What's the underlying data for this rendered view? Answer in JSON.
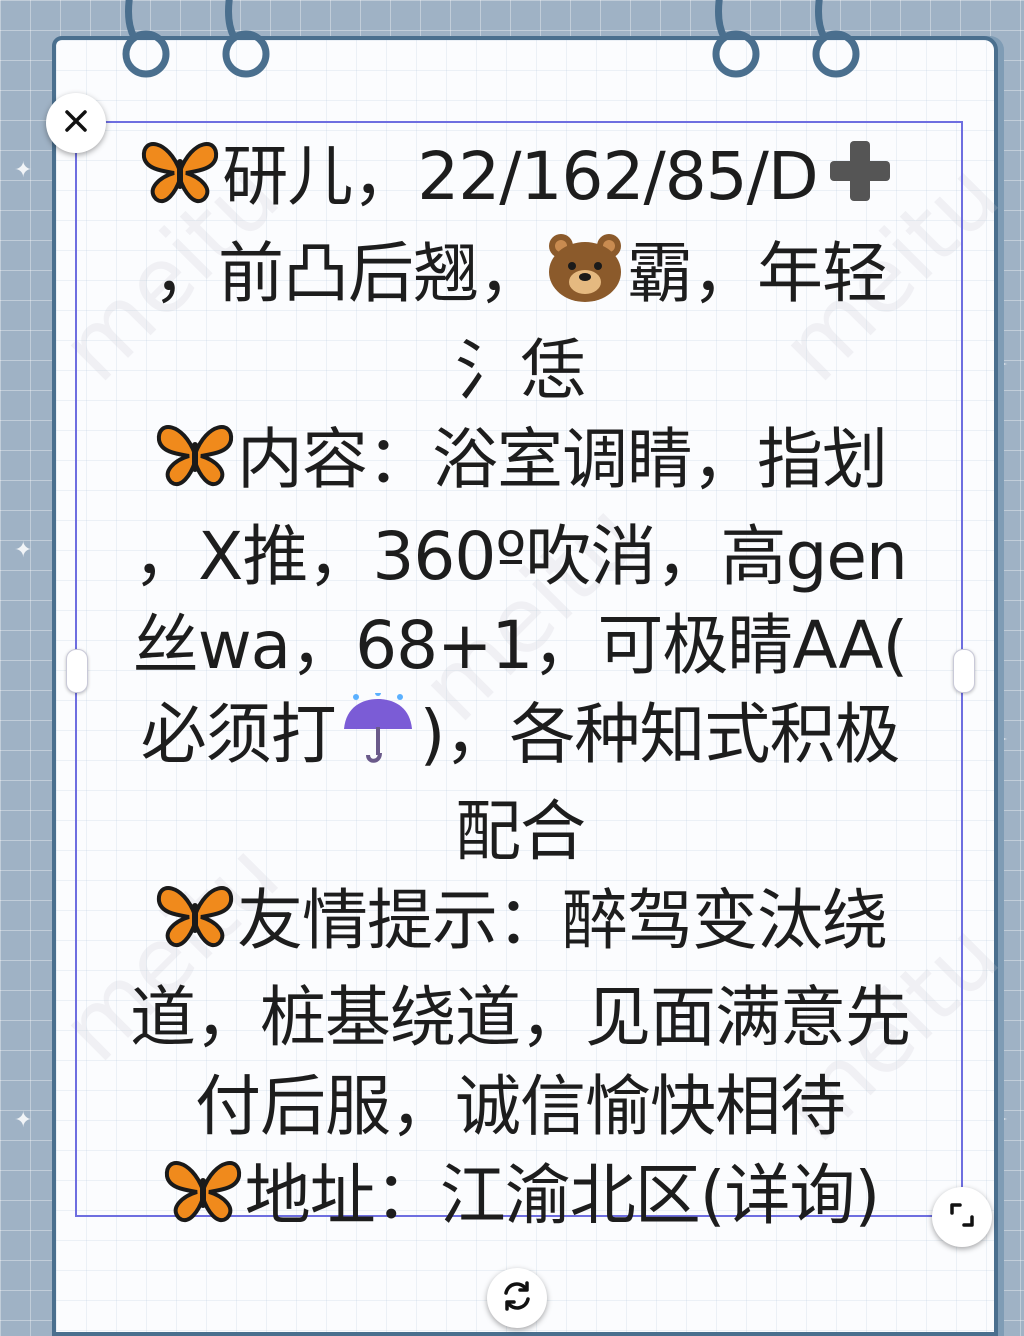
{
  "icons": {
    "close": "close-icon",
    "resize": "resize-corner-icon",
    "rotate": "rotate-icon",
    "butterfly": "butterfly-emoji",
    "plus": "plus-emoji",
    "bear": "bear-face-emoji",
    "umbrella": "umbrella-rain-emoji"
  },
  "colors": {
    "background": "#9fb2c5",
    "paper": "#fbfcfe",
    "selection_frame": "#6e6ee0",
    "text": "#1d1d1d"
  },
  "note": {
    "line1_text": "研儿，22/162/85/D",
    "line2_a": "，前凸后翘，",
    "line2_b": "霸，年轻",
    "line3": "氵恁",
    "line4_text": "内容：浴室调睛，指划",
    "line5": "，X推，360º吹消，高gen",
    "line6": "丝wa，68+1，可极睛AA(",
    "line7_a": "必须打",
    "line7_b": ")，各种知式积极",
    "line8": "配合",
    "line9_text": "友情提示：醉驾变汰绕",
    "line10": "道，桩基绕道，见面满意先",
    "line11": "付后服，诚信愉快相待",
    "line12_text": "地址：江渝北区(详询)"
  },
  "watermark": {
    "text": "meitu"
  }
}
